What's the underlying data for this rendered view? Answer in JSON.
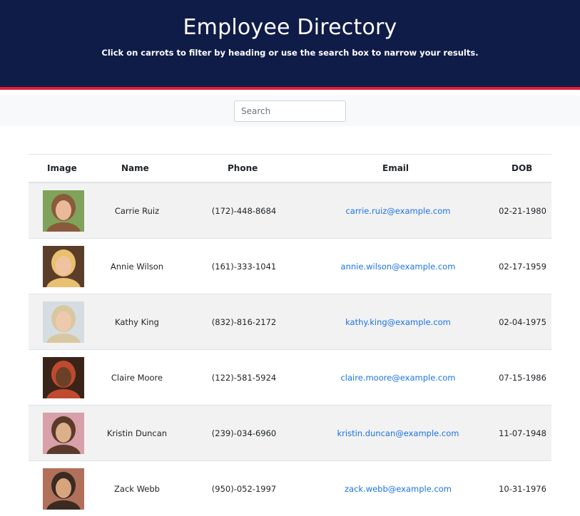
{
  "header": {
    "title": "Employee Directory",
    "subtitle": "Click on carrots to filter by heading or use the search box to narrow your results."
  },
  "search": {
    "placeholder": "Search",
    "value": ""
  },
  "table": {
    "columns": [
      "Image",
      "Name",
      "Phone",
      "Email",
      "DOB"
    ],
    "rows": [
      {
        "name": "Carrie Ruiz",
        "phone": "(172)-448-8684",
        "email": "carrie.ruiz@example.com",
        "dob": "02-21-1980",
        "avatar_bg": "#7fa35a",
        "avatar_skin": "#e9b99a",
        "avatar_hair": "#8a5a3a"
      },
      {
        "name": "Annie Wilson",
        "phone": "(161)-333-1041",
        "email": "annie.wilson@example.com",
        "dob": "02-17-1959",
        "avatar_bg": "#5a3e2a",
        "avatar_skin": "#f0c2a0",
        "avatar_hair": "#e8c070"
      },
      {
        "name": "Kathy King",
        "phone": "(832)-816-2172",
        "email": "kathy.king@example.com",
        "dob": "02-04-1975",
        "avatar_bg": "#d6dde2",
        "avatar_skin": "#efc9ae",
        "avatar_hair": "#d8c8a0"
      },
      {
        "name": "Claire Moore",
        "phone": "(122)-581-5924",
        "email": "claire.moore@example.com",
        "dob": "07-15-1986",
        "avatar_bg": "#3a2418",
        "avatar_skin": "#6b4026",
        "avatar_hair": "#c04a30"
      },
      {
        "name": "Kristin Duncan",
        "phone": "(239)-034-6960",
        "email": "kristin.duncan@example.com",
        "dob": "11-07-1948",
        "avatar_bg": "#d8a0a8",
        "avatar_skin": "#dcb08a",
        "avatar_hair": "#5a3a2a"
      },
      {
        "name": "Zack Webb",
        "phone": "(950)-052-1997",
        "email": "zack.webb@example.com",
        "dob": "10-31-1976",
        "avatar_bg": "#b0705a",
        "avatar_skin": "#d8a47e",
        "avatar_hair": "#3a2a22"
      }
    ]
  },
  "colors": {
    "header_bg": "#0f1c48",
    "accent_red": "#e01e37",
    "link": "#1a73e8",
    "row_stripe": "#f2f2f2"
  }
}
